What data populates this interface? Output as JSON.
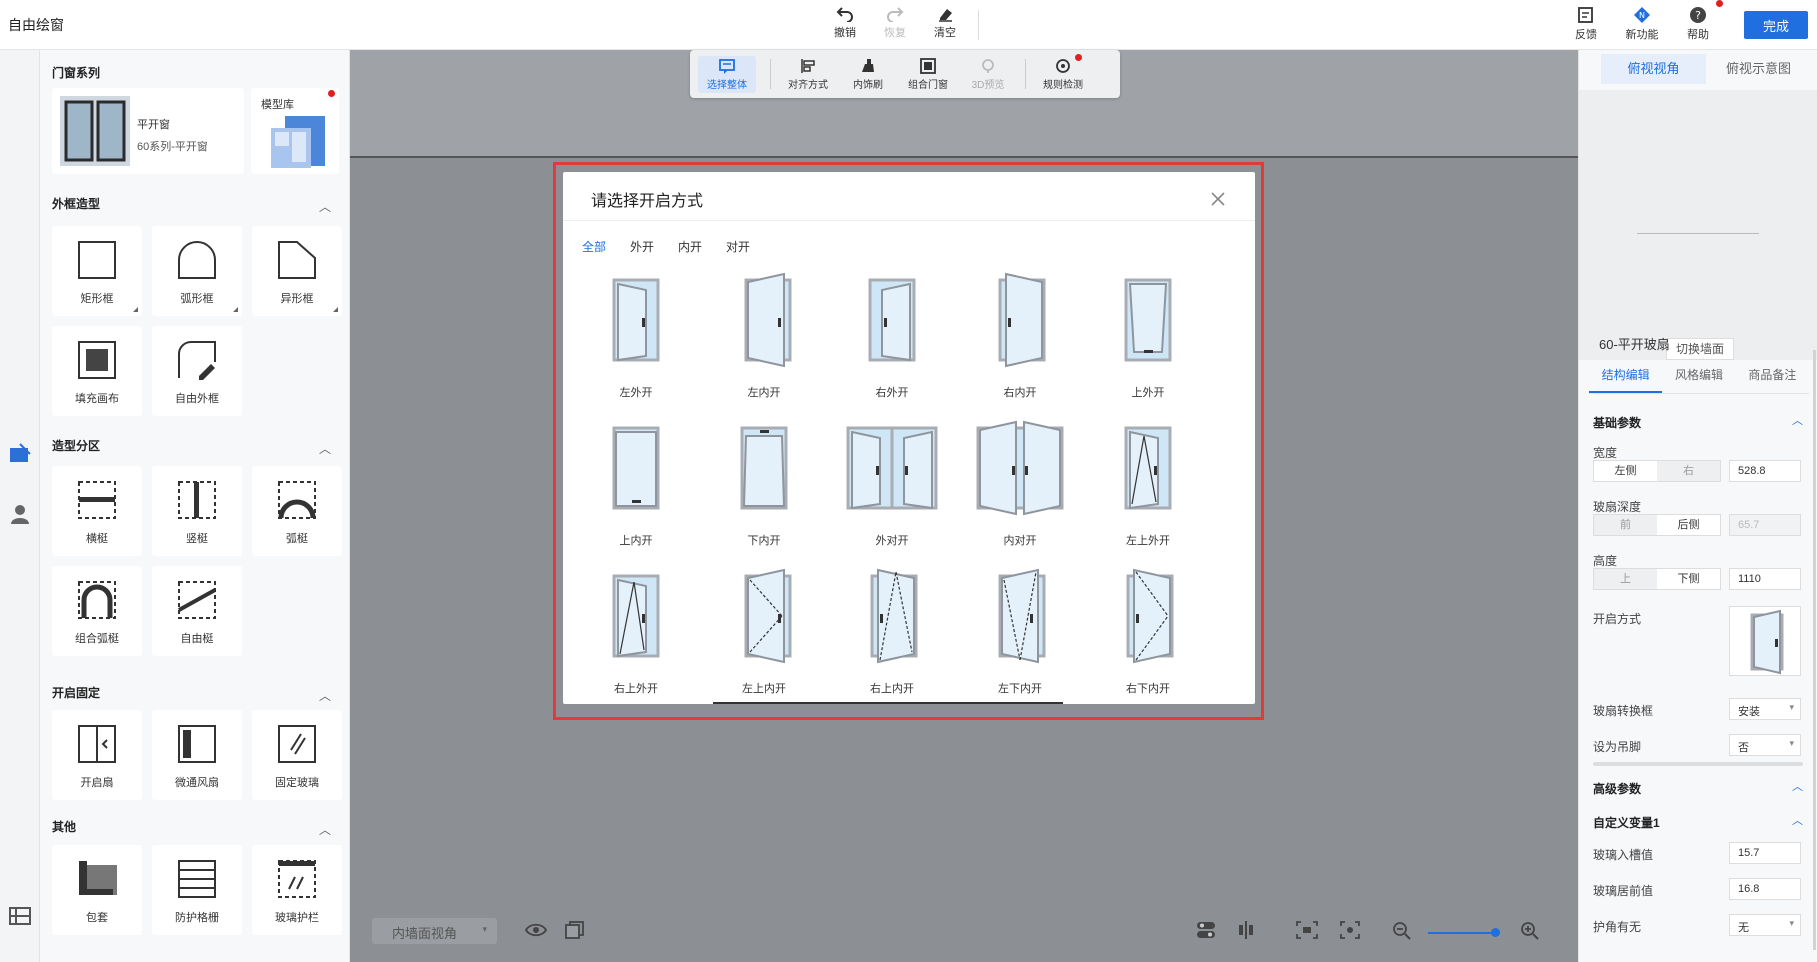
{
  "app": {
    "title": "自由绘窗",
    "done_label": "完成"
  },
  "toolbar": {
    "undo": "撤销",
    "redo": "恢复",
    "clear": "清空",
    "feedback": "反馈",
    "new_features": "新功能",
    "help": "帮助"
  },
  "canvas_toolbar": {
    "select_all": "选择整体",
    "align": "对齐方式",
    "inner_trim": "内饰刷",
    "combo_door": "组合门窗",
    "preview_3d": "3D预览",
    "rule_check": "规则检测"
  },
  "left_panel": {
    "series_section": "门窗系列",
    "series_name": "平开窗",
    "series_sub": "60系列-平开窗",
    "model_lib": "模型库",
    "sections": [
      {
        "title": "外框造型",
        "items": [
          "矩形框",
          "弧形框",
          "异形框",
          "填充画布",
          "自由外框"
        ]
      },
      {
        "title": "造型分区",
        "items": [
          "横梃",
          "竖梃",
          "弧梃",
          "组合弧梃",
          "自由梃"
        ]
      },
      {
        "title": "开启固定",
        "items": [
          "开启扇",
          "微通风扇",
          "固定玻璃"
        ]
      },
      {
        "title": "其他",
        "items": [
          "包套",
          "防护格栅",
          "玻璃护栏"
        ]
      }
    ]
  },
  "bottom_bar": {
    "view_select": "内墙面视角"
  },
  "right_panel": {
    "view_tabs": [
      "俯视视角",
      "俯视示意图"
    ],
    "switch_wall": "切换墙面",
    "title": "60-平开玻扇",
    "sub_tabs": [
      "结构编辑",
      "风格编辑",
      "商品备注"
    ],
    "basic_params": "基础参数",
    "width_label": "宽度",
    "width_seg": [
      "左侧",
      "右"
    ],
    "width_value": "528.8",
    "depth_label": "玻扇深度",
    "depth_seg": [
      "前",
      "后侧"
    ],
    "depth_value": "65.7",
    "height_label": "高度",
    "height_seg": [
      "上",
      "下侧"
    ],
    "height_value": "1110",
    "open_mode_label": "开启方式",
    "glass_frame_label": "玻扇转换框",
    "glass_frame_value": "安装",
    "hanger_label": "设为吊脚",
    "hanger_value": "否",
    "advanced_params": "高级参数",
    "custom_var": "自定义变量1",
    "glass_in_label": "玻璃入槽值",
    "glass_in_value": "15.7",
    "glass_front_label": "玻璃居前值",
    "glass_front_value": "16.8",
    "corner_label": "护角有无",
    "corner_value": "无"
  },
  "modal": {
    "title": "请选择开启方式",
    "filters": [
      "全部",
      "外开",
      "内开",
      "对开"
    ],
    "options": [
      "左外开",
      "左内开",
      "右外开",
      "右内开",
      "上外开",
      "上内开",
      "下内开",
      "外对开",
      "内对开",
      "左上外开",
      "右上外开",
      "左上内开",
      "右上内开",
      "左下内开",
      "右下内开"
    ]
  },
  "colors": {
    "accent": "#1f6fe0",
    "highlight_outline": "#e03a3a",
    "glass": "#cfe6f7",
    "frame": "#a8adb3"
  }
}
